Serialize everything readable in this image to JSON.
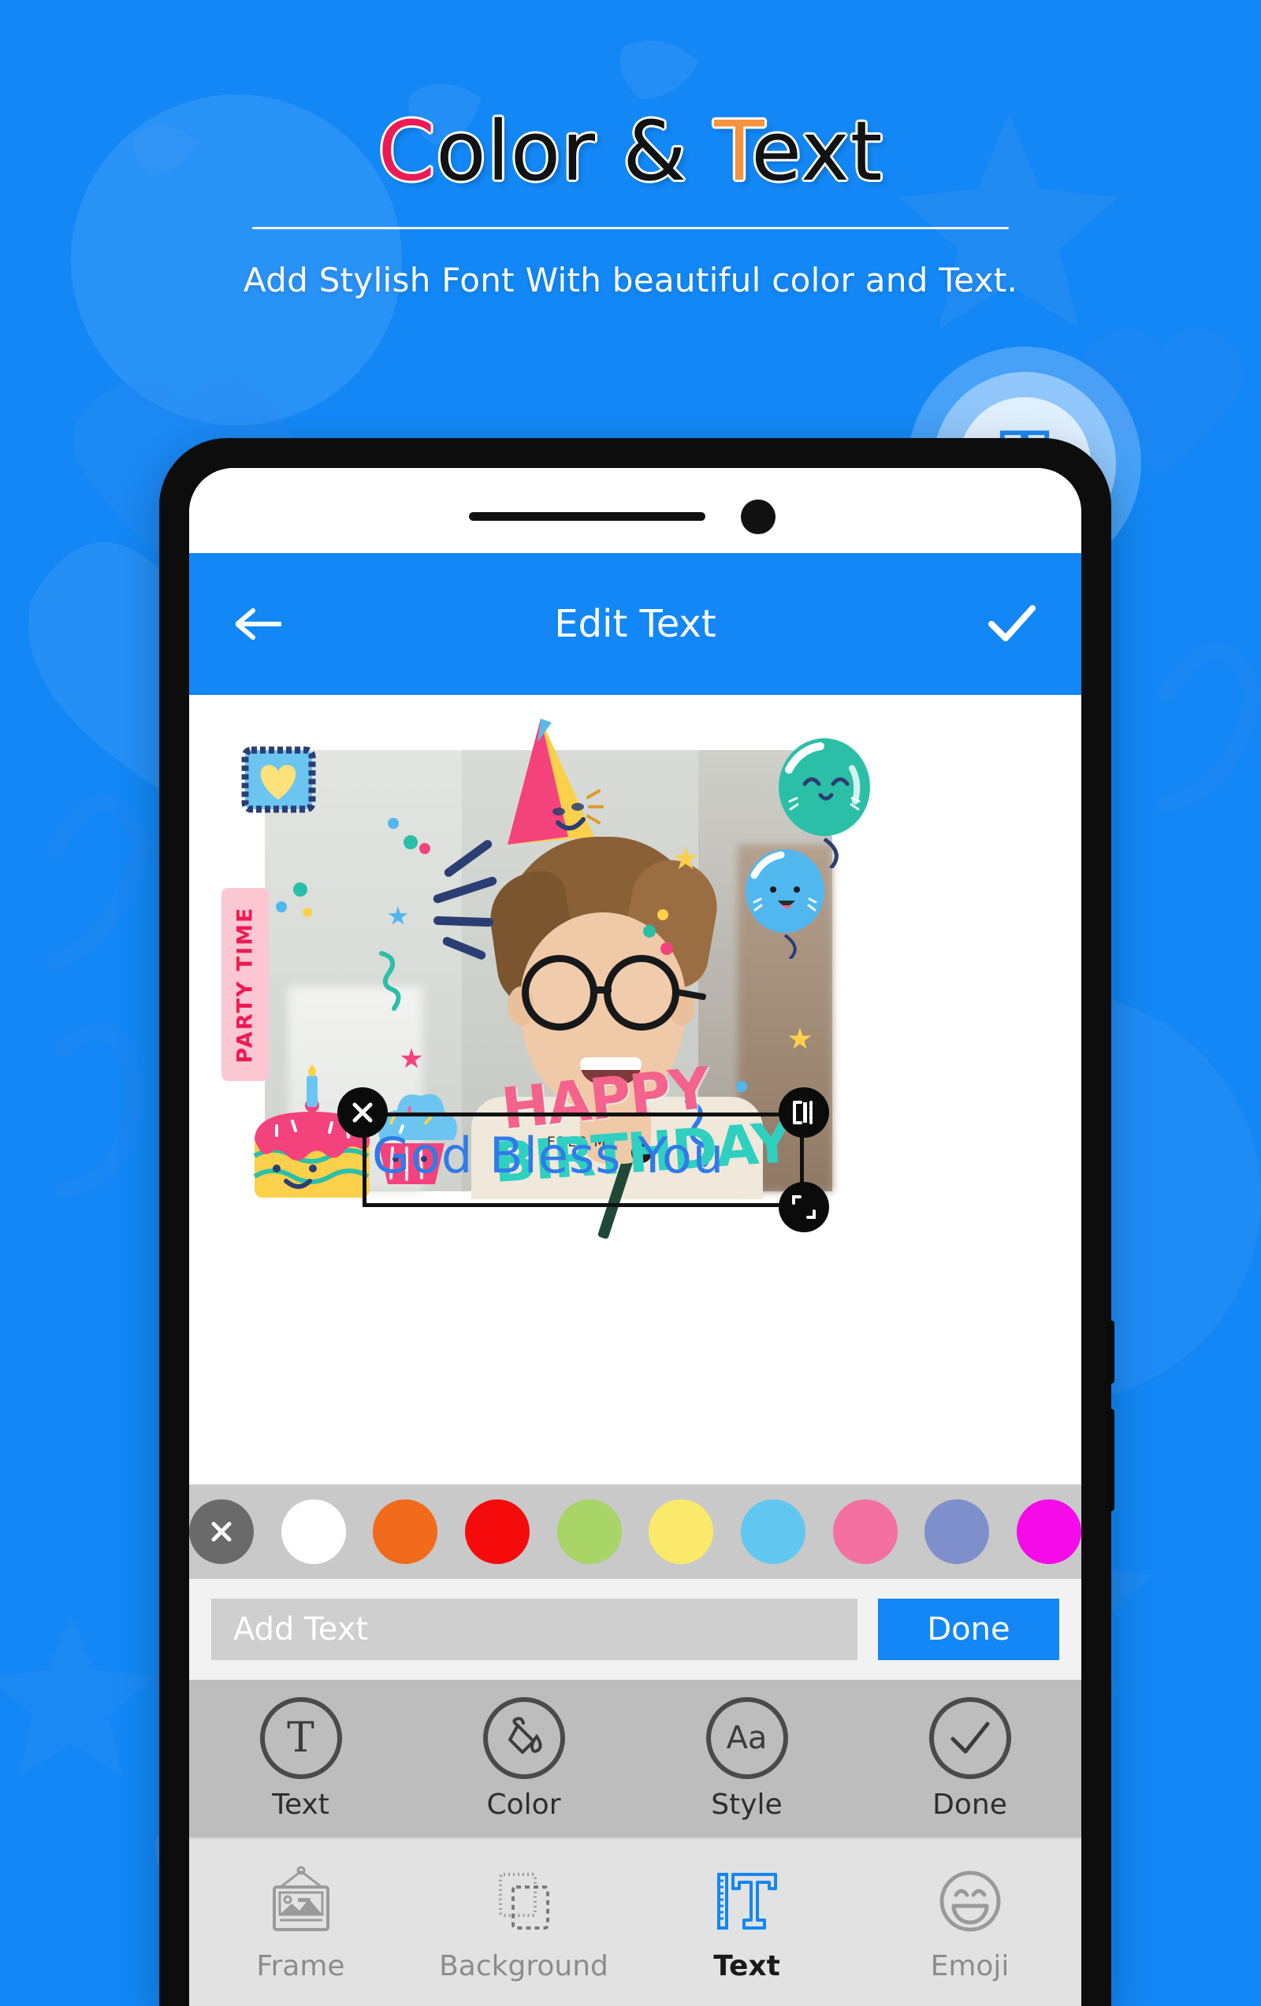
{
  "promo": {
    "title_parts": [
      {
        "text": "C",
        "color": "#ED1A55"
      },
      {
        "text": "olor ",
        "color": "#121212"
      },
      {
        "text": "&",
        "color": "#121212"
      },
      {
        "text": " ",
        "color": "#121212"
      },
      {
        "text": "T",
        "color": "#F6933E"
      },
      {
        "text": "ext",
        "color": "#121212"
      }
    ],
    "title_plain": "Color & Text",
    "subtitle": "Add Stylish Font With beautiful color and Text.",
    "badge_glyph": "T",
    "badge_name": "text-tool-badge"
  },
  "appbar": {
    "title": "Edit Text",
    "back_icon": "arrow-left-icon",
    "confirm_icon": "check-icon",
    "background": "#1287F5"
  },
  "canvas": {
    "overlay_text": "God Bless You",
    "overlay_text_color": "#2F7BE8",
    "handles": {
      "delete": "×",
      "edit": "edit-handle-icon",
      "resize": "resize-handle-icon"
    },
    "stickers": {
      "party_time": "PARTY TIME",
      "happy": "HAPPY",
      "birthday": "BIRTHDAY",
      "shirt_text": "ERES MI"
    }
  },
  "palette": {
    "swatches": [
      {
        "name": "none",
        "color": "#6A6A6A",
        "label": "×"
      },
      {
        "name": "white",
        "color": "#FFFFFF"
      },
      {
        "name": "orange",
        "color": "#F26A1B"
      },
      {
        "name": "red",
        "color": "#F50B0B"
      },
      {
        "name": "light-green",
        "color": "#A8D468"
      },
      {
        "name": "yellow",
        "color": "#FAE96A"
      },
      {
        "name": "light-blue",
        "color": "#62C7F0"
      },
      {
        "name": "pink",
        "color": "#F4709F"
      },
      {
        "name": "periwinkle",
        "color": "#7F8FCB"
      },
      {
        "name": "magenta",
        "color": "#F50BE7"
      }
    ]
  },
  "input_row": {
    "placeholder": "Add Text",
    "value": "",
    "done_label": "Done",
    "done_color": "#1287F5"
  },
  "tools": [
    {
      "label": "Text",
      "icon": "text-t-icon"
    },
    {
      "label": "Color",
      "icon": "paint-bucket-icon"
    },
    {
      "label": "Style",
      "icon": "font-style-aa-icon"
    },
    {
      "label": "Done",
      "icon": "check-circle-icon"
    }
  ],
  "bottom_nav": {
    "active": "Text",
    "items": [
      {
        "label": "Frame",
        "icon": "picture-frame-icon",
        "active": false
      },
      {
        "label": "Background",
        "icon": "layers-icon",
        "active": false
      },
      {
        "label": "Text",
        "icon": "text-ruler-icon",
        "active": true
      },
      {
        "label": "Emoji",
        "icon": "smiley-icon",
        "active": false
      }
    ]
  }
}
